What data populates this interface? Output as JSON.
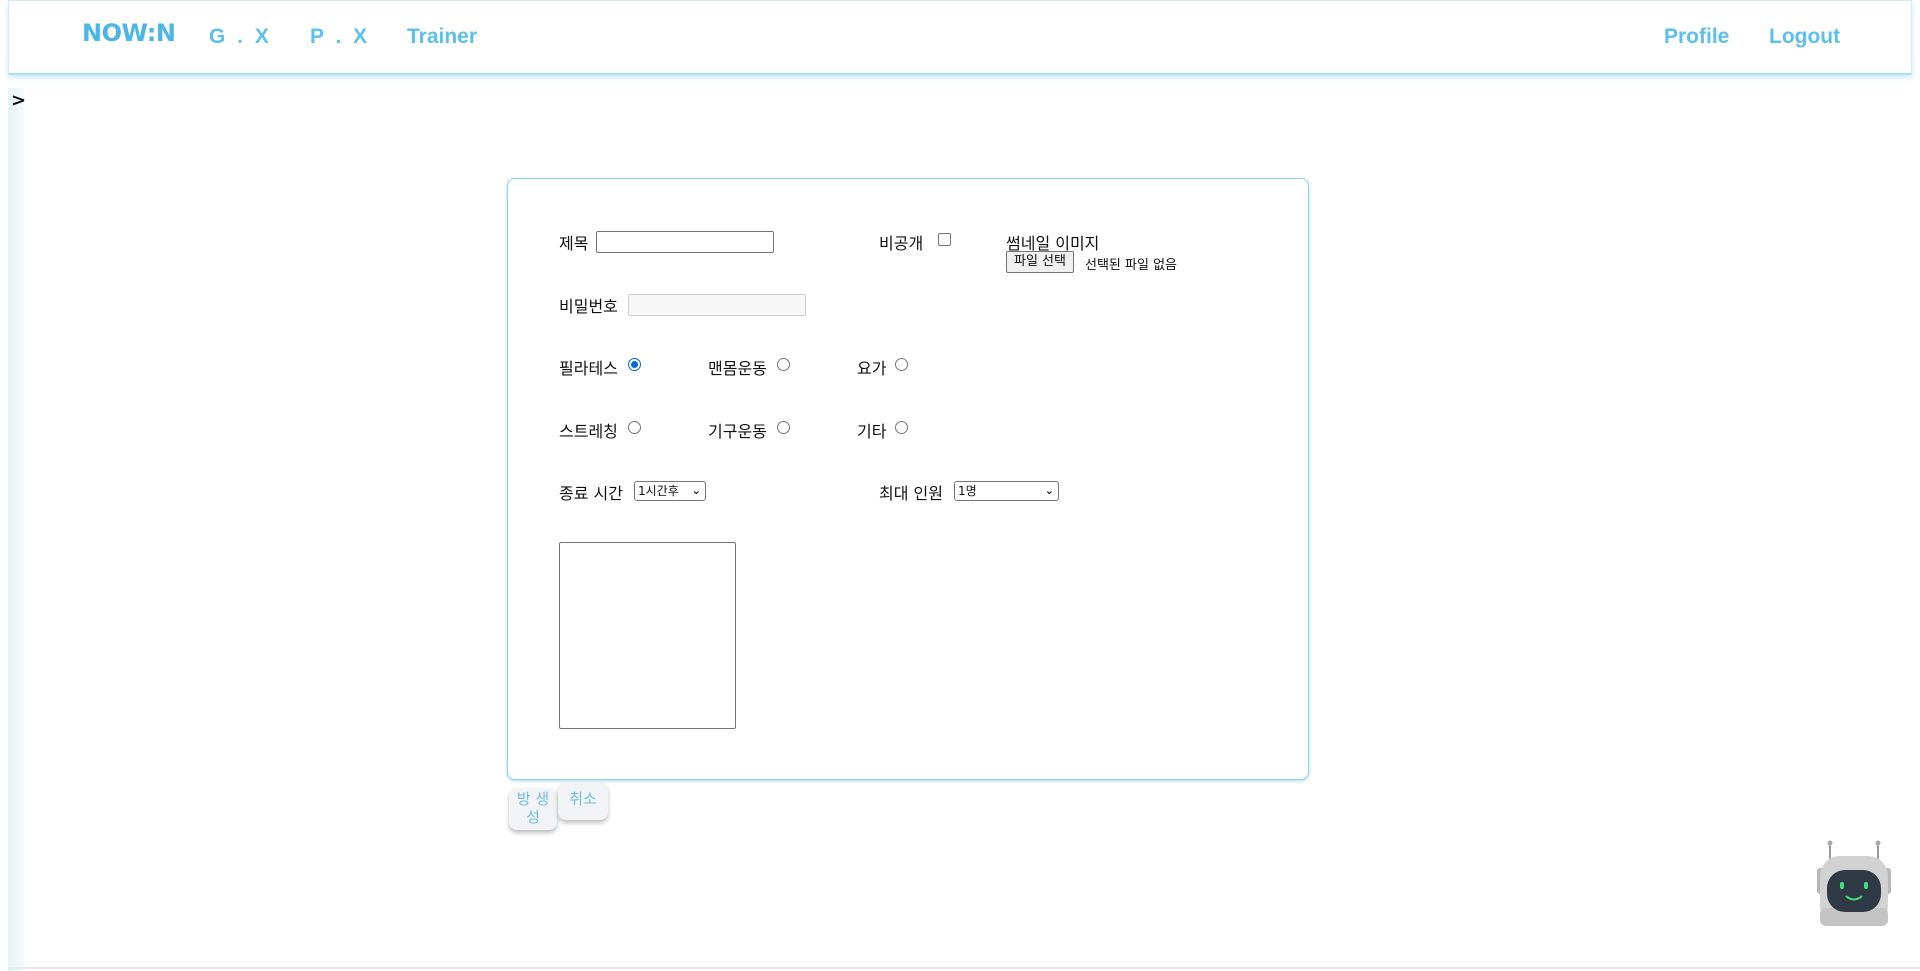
{
  "nav": {
    "logo": "NOW:N",
    "gx": "G . X",
    "px": "P . X",
    "trainer": "Trainer",
    "profile": "Profile",
    "logout": "Logout"
  },
  "sidebar": {
    "toggle": ">"
  },
  "form": {
    "title_label": "제목",
    "title_value": "",
    "private_label": "비공개",
    "private_checked": false,
    "thumbnail_label": "썸네일 이미지",
    "file_button": "파일 선택",
    "file_status": "선택된 파일 없음",
    "password_label": "비밀번호",
    "password_value": "",
    "categories": [
      {
        "label": "필라테스",
        "checked": true
      },
      {
        "label": "맨몸운동",
        "checked": false
      },
      {
        "label": "요가",
        "checked": false
      },
      {
        "label": "스트레칭",
        "checked": false
      },
      {
        "label": "기구운동",
        "checked": false
      },
      {
        "label": "기타",
        "checked": false
      }
    ],
    "end_time_label": "종료 시간",
    "end_time_selected": "1시간후",
    "max_people_label": "최대 인원",
    "max_people_selected": "1명",
    "description_value": ""
  },
  "actions": {
    "create": "방 생성",
    "cancel": "취소"
  },
  "chatbot": {
    "icon": "robot-icon"
  },
  "colors": {
    "accent": "#5cc0ec",
    "logo": "#4db6e8",
    "card_border": "#8fd4ef",
    "radio_checked": "#0b66d6"
  }
}
